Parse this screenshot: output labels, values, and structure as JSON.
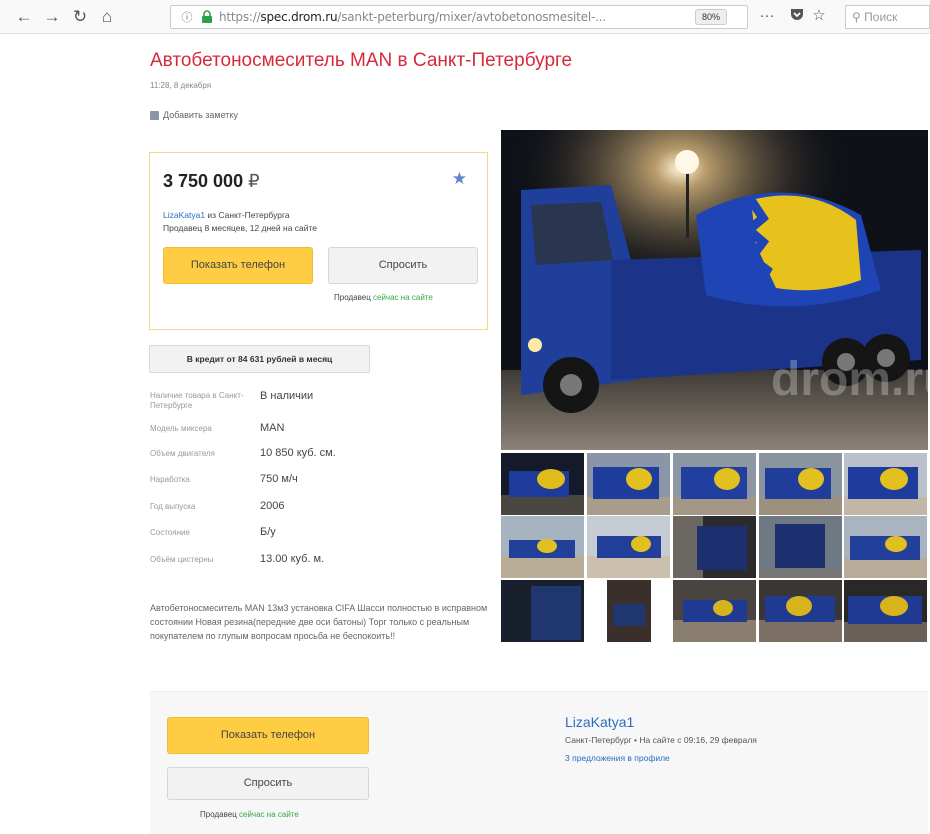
{
  "browser": {
    "url_domain": "spec.drom.ru",
    "url_rest": "/sankt-peterburg/mixer/avtobetonosmesitel-...",
    "url_prefix": "https://",
    "zoom": "80%",
    "search_placeholder": "Поиск"
  },
  "listing": {
    "title": "Автобетоносмеситель MAN в Санкт-Петербурге",
    "date": "11:28, 8 декабря",
    "add_note": "Добавить заметку",
    "price": "3 750 000",
    "currency": "₽",
    "seller_name": "LizaKatya1",
    "seller_city": " из Санкт-Петербурга",
    "seller_duration": "Продавец 8 месяцев, 12 дней на сайте",
    "show_phone": "Показать телефон",
    "ask": "Спросить",
    "online_prefix": "Продавец ",
    "online_status": "сейчас на сайте",
    "credit": "В кредит от 84 631 рублей в месяц"
  },
  "specs": [
    {
      "label": "Наличие товара в Санкт-Петербурге",
      "value": "В наличии"
    },
    {
      "label": "Модель миксера",
      "value": "MAN"
    },
    {
      "label": "Объем двигателя",
      "value": "10 850 куб. см."
    },
    {
      "label": "Наработка",
      "value": "750 м/ч"
    },
    {
      "label": "Год выпуска",
      "value": "2006"
    },
    {
      "label": "Состояние",
      "value": "Б/у"
    },
    {
      "label": "Объём цистерны",
      "value": "13.00 куб. м."
    }
  ],
  "description": "Автобетоносмеситель MAN 13м3 установка CIFA Шасси полностью в исправном состоянии Новая резина(передние две оси батоны) Торг только с реальным покупателем по глупым вопросам просьба не беспокоить!!",
  "watermark": "drom.ru",
  "bottom": {
    "show_phone": "Показать телефон",
    "ask": "Спросить",
    "online_prefix": "Продавец ",
    "online_status": "сейчас на сайте",
    "seller_name": "LizaKatya1",
    "seller_meta": "Санкт-Петербург  •  На сайте с 09:16, 29 февраля",
    "offers_link": "3 предложения в профиле"
  },
  "colors": {
    "title": "#d62a3b",
    "accent_button": "#ffcd43",
    "link": "#2b6cc4",
    "online": "#33aa44"
  }
}
